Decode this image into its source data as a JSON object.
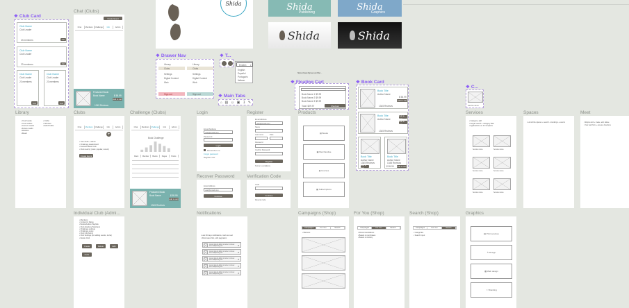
{
  "frames": {
    "chat_clubs": "Chat (Clubs)",
    "library": "Library",
    "clubs": "Clubs",
    "challenge_clubs": "Challenge (Clubs)",
    "login": "Login",
    "register": "Register",
    "recover_password": "Recover Password",
    "verification_code": "Verification Code",
    "products": "Products",
    "services": "Services",
    "spaces": "Spaces",
    "meet": "Meet",
    "individual_club": "Individual Club (Admi...",
    "notifications": "Notifications",
    "campaigns_shop": "Campaigns (Shop)",
    "for_you_shop": "For You (Shop)",
    "search_shop": "Search (Shop)",
    "graphics": "Graphics"
  },
  "components": {
    "club_card": "Club Card",
    "drawer_nav": "Drawer Nav",
    "t": "T...",
    "main_tabs": "Main Tabs",
    "floating_cart": "Floating Cart",
    "book_card": "Book Card",
    "c": "C..."
  },
  "brand": {
    "shida": "Shida",
    "publishing": "Publishing",
    "graphics": "Graphics"
  },
  "club_card": {
    "name": "Club Name",
    "sub": "Club Leader",
    "members": "23 members",
    "join": "Join"
  },
  "chat": {
    "tabs": [
      "Chat",
      "Members",
      "Challenge",
      "Info",
      "Admin"
    ],
    "create": "Create Event",
    "featured": "Featured Book",
    "title": "Book Name",
    "price": "$ 55.99",
    "add": "Add to cart",
    "reviews": "1345 Reviews"
  },
  "drawer": {
    "items": [
      "Library",
      "Clubs",
      "Settings",
      "Digital Content",
      "Web",
      "Sign out"
    ]
  },
  "lang": {
    "current": "English",
    "options": [
      "English",
      "Español",
      "Português",
      "Italiano"
    ]
  },
  "main_tabs": {
    "icons": [
      "home-icon",
      "book-icon",
      "people-icon",
      "bag-icon",
      "bell-icon",
      "pen-icon"
    ]
  },
  "url": "https://www.figma.com/file/...",
  "floating_cart": {
    "items": [
      "Book Name 1 $9.99",
      "Book Name 2 $9.99",
      "Book Name 3 $9.99"
    ],
    "total": "Total: $29.97",
    "checkout": "Checkout"
  },
  "book_card": {
    "title": "Book Title",
    "author": "Author Name",
    "price": "$ 55.99",
    "reviews": "1345 Reviews",
    "add": "Add to cart"
  },
  "library": {
    "list1": "• Your books\n• Your audios\n• Current reads\n• Future reads\n• Wishlist\n• Read",
    "list2": "• Clubs\n• Shelves\n• Edit Profile"
  },
  "clubs_list": "• Your clubs + admin\n• Challenge leaderboard\n• Featured Book Club\n• Club near by (Lists: popular, recent)",
  "challenge": {
    "tabs": [
      "Chat",
      "Members",
      "Challenge",
      "Info",
      "Admin"
    ],
    "title": "Book Challenge",
    "bars": [
      3,
      6,
      9,
      14,
      11,
      8,
      5
    ],
    "table_head": [
      "Rank",
      "Member",
      "Books",
      "Pages",
      "Points"
    ]
  },
  "login": {
    "email_label": "Email Address",
    "email": "user@email.com",
    "pass_label": "Password",
    "login": "Login",
    "remember": "Remember me",
    "forgot": "Forgot password",
    "register": "Register now"
  },
  "register": {
    "fields": [
      "Email Address",
      "Name",
      "Last name",
      "Date",
      "Password",
      "Confirm Password"
    ],
    "button": "Register",
    "terms": "Terms & conditions"
  },
  "recover": {
    "label": "Email Address",
    "button": "Continue"
  },
  "verify": {
    "label": "Code",
    "button": "Continue",
    "resend": "Resend code"
  },
  "products": [
    "Books",
    "Merchandise",
    "Courses",
    "Subscriptions"
  ],
  "services_list": "• Category: add\n• Single search + category filter\n• Applications on for Graphics",
  "spaces_list": "• List all the spaces + search + bookings + events",
  "meet_list": "• Simple card + create, edit, delete\n• Your card form + access, directions",
  "service_label": "Service name",
  "individual": {
    "list": "• Members\n• Content & Dates\n• Books/Audios Playlists\n• Club details w/ Members\n• Challenge settings\n• Challenge setup\n• Club Info Admin\n• Club Settings (for adding events, invite)\n• Delete Club",
    "buttons": [
      "Create",
      "Delete",
      "Edit",
      "Invite"
    ]
  },
  "notifications": {
    "intro": "• Last 30 days notifications, mark as read\n• Show latest first, with pagination",
    "item": "Lorem ipsum dolor sit amet, consec tetur adipiscing elit"
  },
  "shop_tabs": [
    "Campaigns",
    "For You",
    "Search"
  ],
  "campaigns_list": "• Banners",
  "foryou_list": "• Recommendations\n• Based on purchases\n• Based on activity",
  "search_list": "• Categories\n• Search input",
  "graphics": [
    "Print services",
    "Design",
    "Web design",
    "Branding"
  ]
}
